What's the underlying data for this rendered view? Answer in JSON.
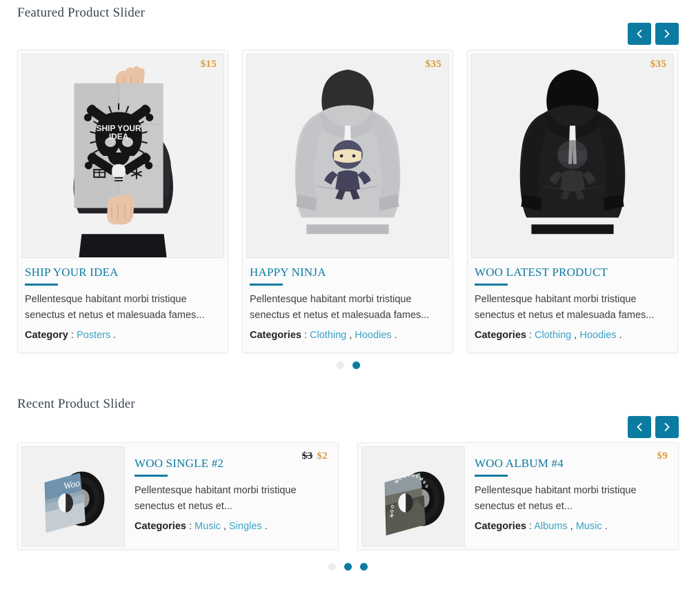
{
  "featured": {
    "heading": "Featured Product Slider",
    "prev_label": "‹",
    "next_label": "›",
    "products": [
      {
        "title": "SHIP YOUR IDEA",
        "price": "$15",
        "description": "Pellentesque habitant morbi tristique senectus et netus et malesuada fames...",
        "category_label": "Category",
        "categories": [
          "Posters"
        ],
        "image_alt": "person-holding-ship-your-idea-poster"
      },
      {
        "title": "HAPPY NINJA",
        "price": "$35",
        "description": "Pellentesque habitant morbi tristique senectus et netus et malesuada fames...",
        "category_label": "Categories",
        "categories": [
          "Clothing",
          "Hoodies"
        ],
        "image_alt": "grey-hoodie-with-ninja-graphic"
      },
      {
        "title": "WOO LATEST PRODUCT",
        "price": "$35",
        "description": "Pellentesque habitant morbi tristique senectus et netus et malesuada fames...",
        "category_label": "Categories",
        "categories": [
          "Clothing",
          "Hoodies"
        ],
        "image_alt": "black-hoodie-with-ninja-graphic"
      }
    ],
    "dots": [
      {
        "active": false
      },
      {
        "active": true
      }
    ]
  },
  "recent": {
    "heading": "Recent Product Slider",
    "prev_label": "‹",
    "next_label": "›",
    "products": [
      {
        "title": "WOO SINGLE #2",
        "old_price": "$3",
        "price": "$2",
        "description": "Pellentesque habitant morbi tristique senectus et netus et...",
        "category_label": "Categories",
        "categories": [
          "Music",
          "Singles"
        ],
        "image_alt": "vinyl-record-woo-sleeve"
      },
      {
        "title": "WOO ALBUM #4",
        "old_price": "",
        "price": "$9",
        "description": "Pellentesque habitant morbi tristique senectus et netus et...",
        "category_label": "Categories",
        "categories": [
          "Albums",
          "Music"
        ],
        "image_alt": "vinyl-record-woothemes-sleeve"
      }
    ],
    "dots": [
      {
        "active": false
      },
      {
        "active": true
      },
      {
        "active": true
      }
    ]
  },
  "separators": {
    "colon": " : ",
    "comma": " , ",
    "period": " ."
  },
  "colors": {
    "accent_teal": "#0c7ba1",
    "price_orange": "#dd9933",
    "link_blue": "#3ba3c4",
    "heading_slate": "#3b4653",
    "card_bg": "#fbfbfb",
    "card_border": "#eaeaea",
    "dot_inactive": "#ececec"
  }
}
